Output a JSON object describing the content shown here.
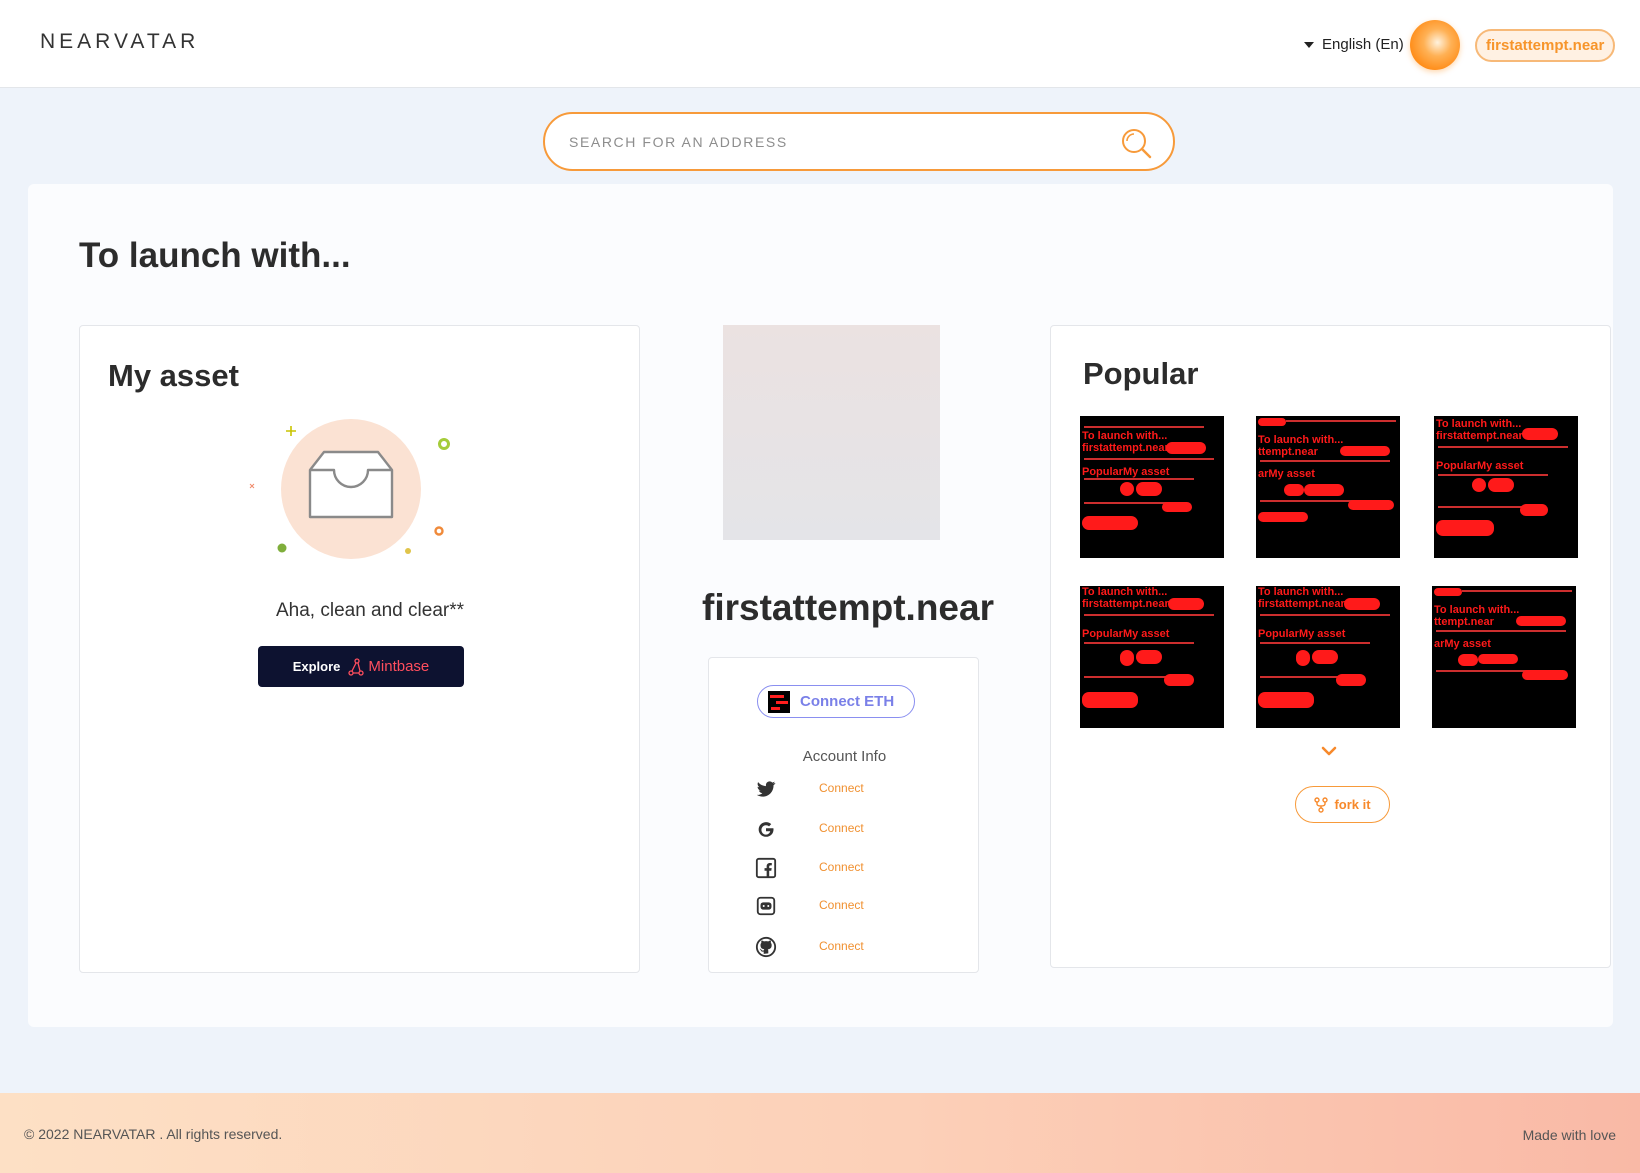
{
  "header": {
    "logo": "NEARVATAR",
    "language": "English (En)",
    "account": "firstattempt.near"
  },
  "search": {
    "placeholder": "SEARCH FOR AN ADDRESS"
  },
  "main": {
    "title": "To launch with...",
    "my_asset": {
      "title": "My asset",
      "empty_text": "Aha, clean and clear**",
      "explore_label": "Explore",
      "explore_brand": "Mintbase"
    },
    "profile": {
      "account_name": "firstattempt.near",
      "connect_eth_label": "Connect ETH",
      "account_info_label": "Account Info",
      "socials": [
        {
          "icon": "twitter-icon",
          "action": "Connect"
        },
        {
          "icon": "google-icon",
          "action": "Connect"
        },
        {
          "icon": "facebook-icon",
          "action": "Connect"
        },
        {
          "icon": "discord-icon",
          "action": "Connect"
        },
        {
          "icon": "github-icon",
          "action": "Connect"
        }
      ]
    },
    "popular": {
      "title": "Popular",
      "fork_label": "fork it",
      "expand_icon": "chevron-down-icon"
    }
  },
  "footer": {
    "copyright": "© 2022 NEARVATAR . All rights reserved.",
    "made_with": "Made with love"
  },
  "colors": {
    "accent": "#f79a3a",
    "eth_accent": "#7a80e8",
    "dark_button": "#0d1230"
  }
}
